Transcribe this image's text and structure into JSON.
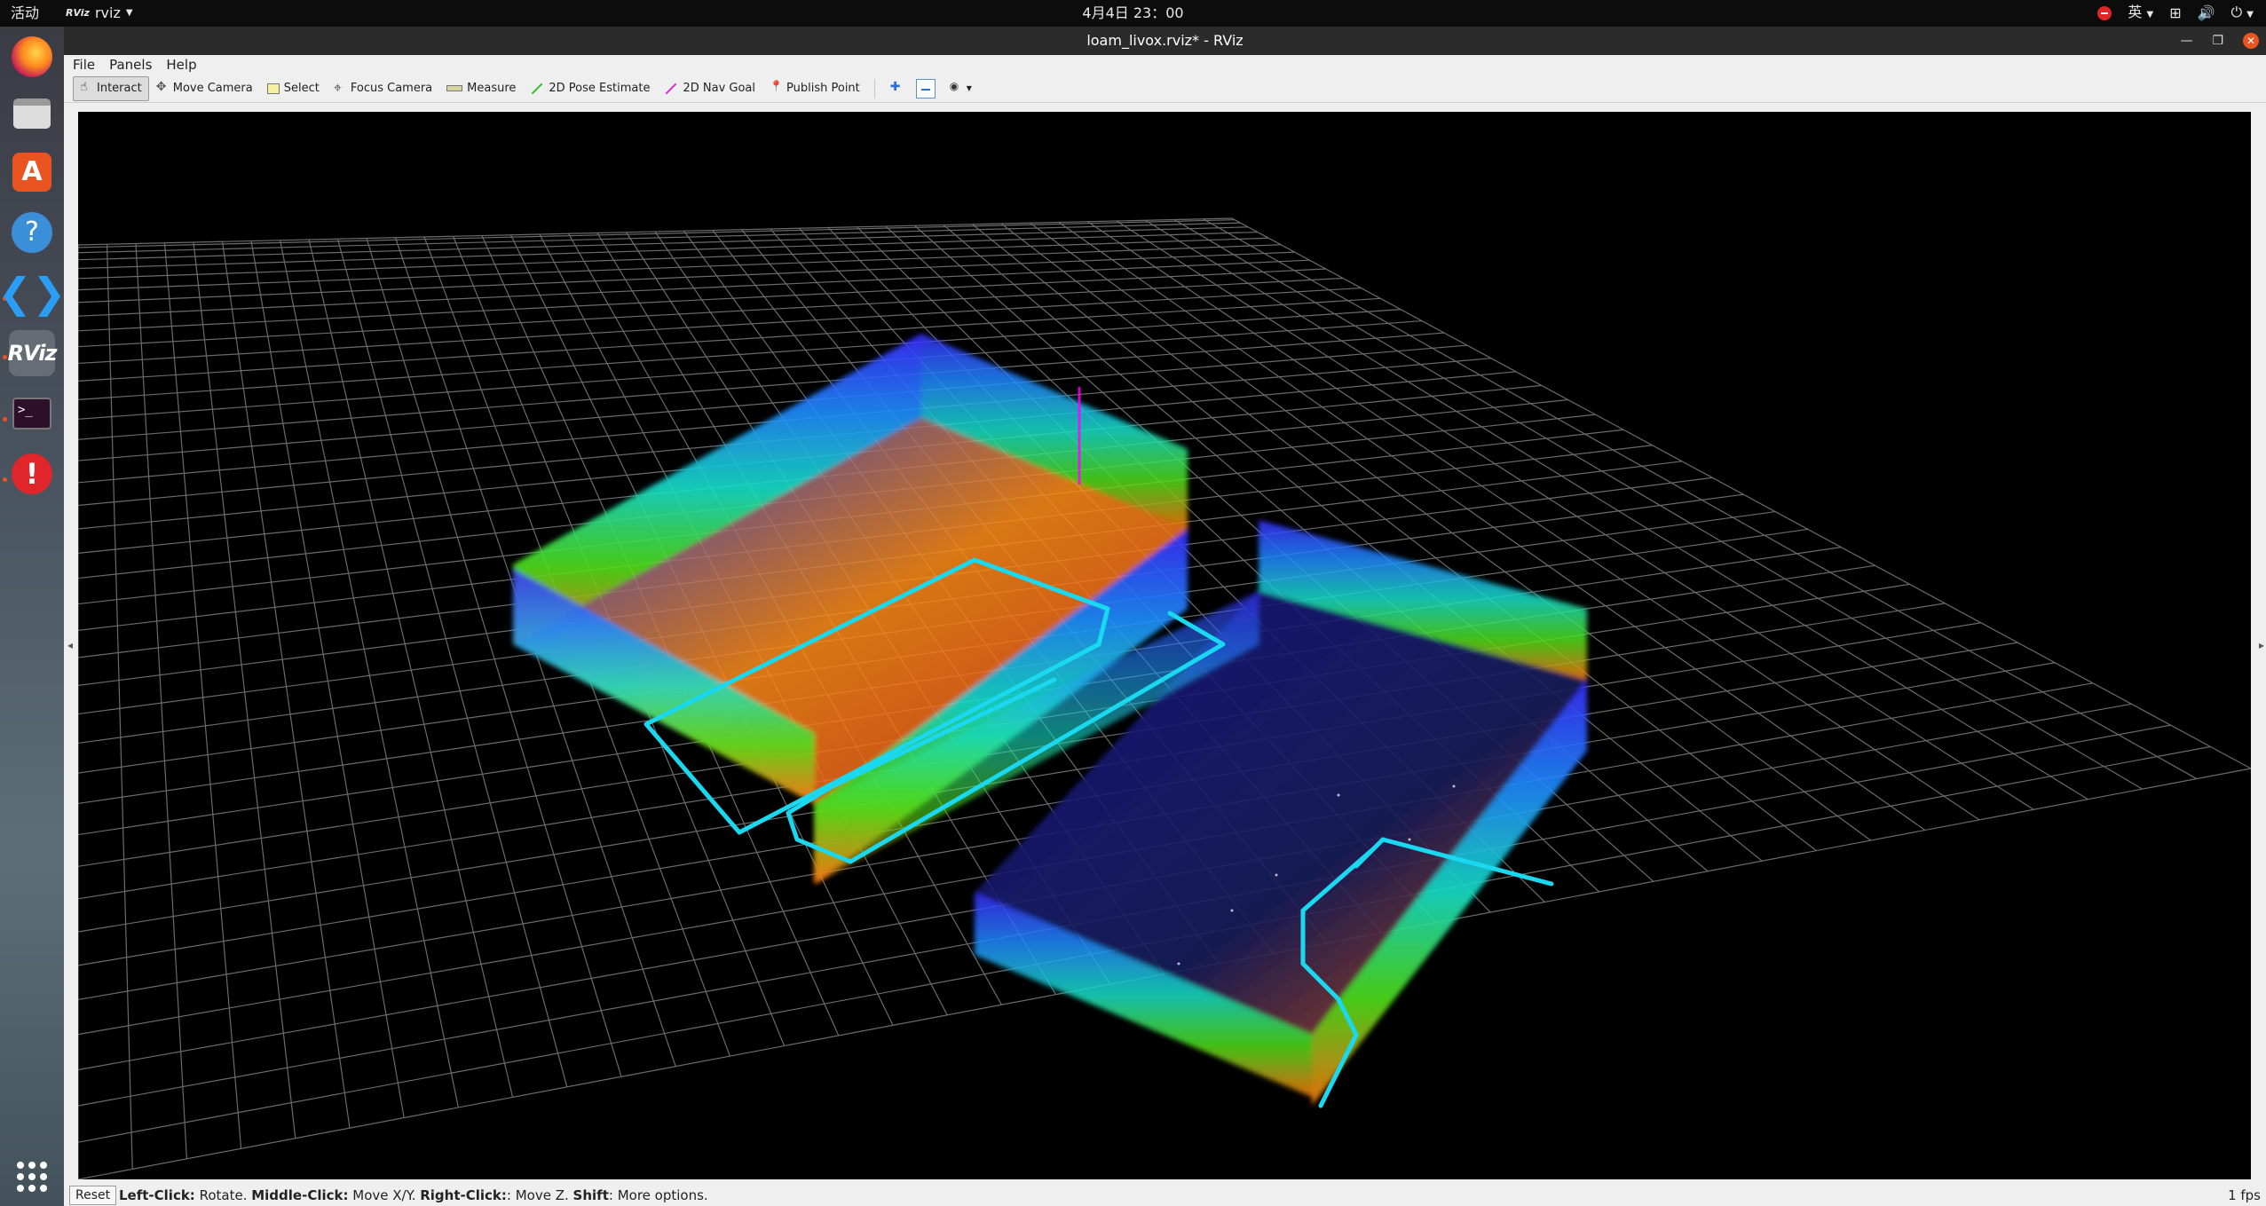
{
  "system_bar": {
    "activities": "活动",
    "app_name": "rviz",
    "app_icon_text": "RViz",
    "clock": "4月4日 23：00",
    "input_method": "英"
  },
  "window": {
    "title": "loam_livox.rviz* - RViz"
  },
  "menu": {
    "file": "File",
    "panels": "Panels",
    "help": "Help"
  },
  "toolbar": {
    "interact": "Interact",
    "move_camera": "Move Camera",
    "select": "Select",
    "focus_camera": "Focus Camera",
    "measure": "Measure",
    "pose_estimate": "2D Pose Estimate",
    "nav_goal": "2D Nav Goal",
    "publish_point": "Publish Point"
  },
  "dock": {
    "rviz_label": "RViz",
    "terminal_prompt": ">_"
  },
  "status": {
    "reset": "Reset",
    "left_click_key": "Left-Click:",
    "left_click_action": " Rotate. ",
    "middle_click_key": "Middle-Click:",
    "middle_click_action": " Move X/Y. ",
    "right_click_key": "Right-Click:",
    "right_click_action": ": Move Z. ",
    "shift_key": "Shift",
    "shift_action": ": More options.",
    "fps": "1 fps"
  },
  "colors": {
    "accent": "#e95420",
    "trajectory": "#19d8f0",
    "grid": "#9a9a9a"
  }
}
